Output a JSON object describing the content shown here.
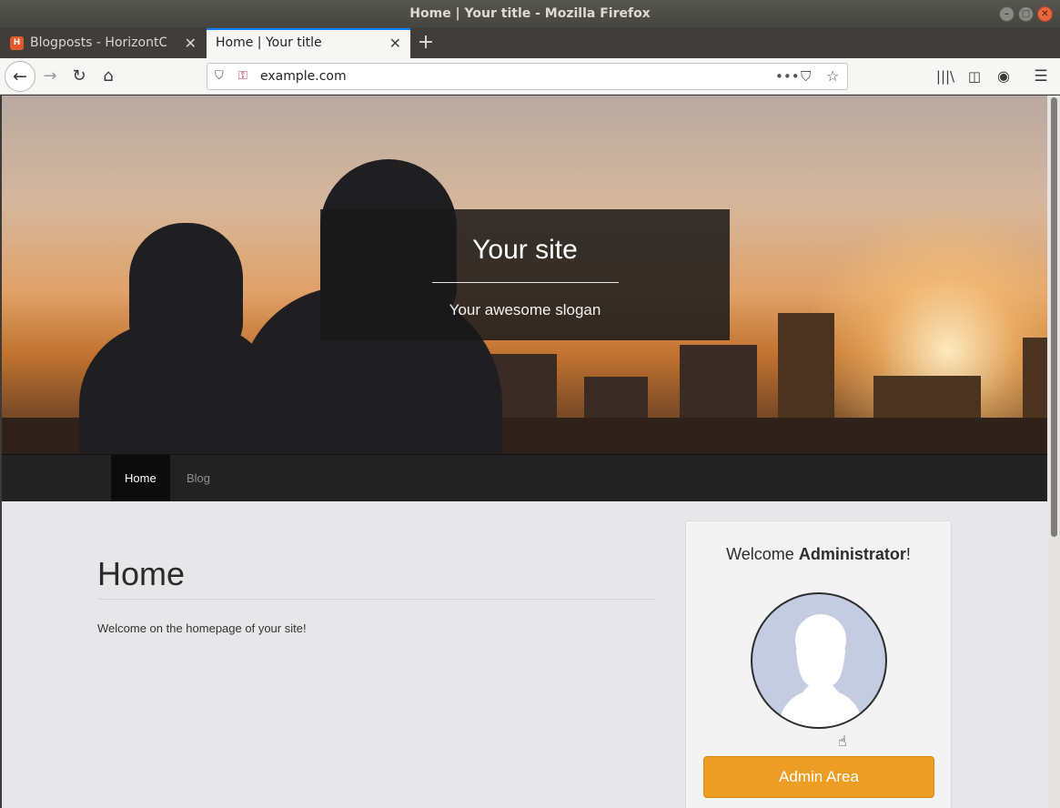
{
  "window": {
    "title": "Home | Your title - Mozilla Firefox"
  },
  "tabs": [
    {
      "label": "Blogposts - HorizontCMS",
      "favicon": "H",
      "active": false
    },
    {
      "label": "Home | Your title",
      "active": true
    }
  ],
  "toolbar": {
    "url": "example.com",
    "icons": [
      "back-icon",
      "forward-icon",
      "reload-icon",
      "home-icon",
      "shield-icon",
      "insecure-lock-icon",
      "more-icon",
      "pocket-icon",
      "bookmark-star-icon",
      "library-icon",
      "sidebar-icon",
      "account-icon",
      "menu-icon"
    ]
  },
  "hero": {
    "title": "Your site",
    "slogan": "Your awesome slogan"
  },
  "site_nav": {
    "items": [
      {
        "label": "Home",
        "active": true
      },
      {
        "label": "Blog",
        "active": false
      }
    ]
  },
  "main": {
    "title": "Home",
    "text": "Welcome on the homepage of your site!"
  },
  "sidebar": {
    "welcome_prefix": "Welcome ",
    "username": "Administrator",
    "welcome_suffix": "!",
    "admin_button": "Admin Area"
  },
  "colors": {
    "accent": "#ec9d24",
    "nav_bg": "#232223",
    "tab_highlight": "#0a84ff"
  }
}
